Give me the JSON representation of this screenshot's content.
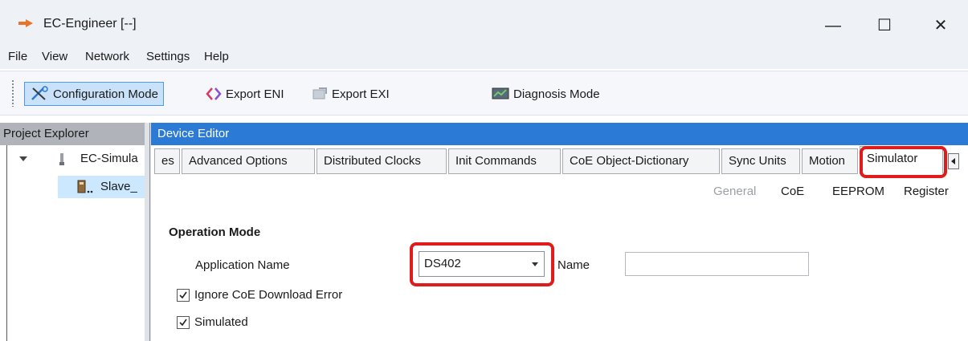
{
  "window": {
    "title": "EC-Engineer [--]",
    "controls": {
      "minimize": "—",
      "maximize": "☐",
      "close": "✕"
    }
  },
  "menu": {
    "items": [
      "File",
      "View",
      "Network",
      "Settings",
      "Help"
    ]
  },
  "toolbar": {
    "configuration_mode": "Configuration Mode",
    "export_eni": "Export ENI",
    "export_exi": "Export EXI",
    "diagnosis_mode": "Diagnosis Mode"
  },
  "project_explorer": {
    "title": "Project Explorer",
    "tree": [
      {
        "label": "EC-Simula",
        "icon": "network-node-icon",
        "expanded": true
      },
      {
        "label": "Slave_",
        "icon": "slave-device-icon",
        "selected": true
      }
    ]
  },
  "device_editor": {
    "title": "Device Editor",
    "tabs": [
      {
        "label": "es",
        "selected": false
      },
      {
        "label": "Advanced Options",
        "selected": false
      },
      {
        "label": "Distributed Clocks",
        "selected": false
      },
      {
        "label": "Init Commands",
        "selected": false
      },
      {
        "label": "CoE Object-Dictionary",
        "selected": false
      },
      {
        "label": "Sync Units",
        "selected": false
      },
      {
        "label": "Motion",
        "selected": false
      },
      {
        "label": "Simulator",
        "selected": true
      }
    ],
    "subnav": [
      {
        "label": "General",
        "active": true
      },
      {
        "label": "CoE",
        "active": false
      },
      {
        "label": "EEPROM",
        "active": false
      },
      {
        "label": "Register",
        "active": false
      }
    ],
    "operation_mode": {
      "title": "Operation Mode",
      "application_name_label": "Application Name",
      "application_name_value": "DS402",
      "name_label": "Name",
      "name_value": "",
      "ignore_coe_label": "Ignore CoE Download Error",
      "ignore_coe_checked": true,
      "simulated_label": "Simulated",
      "simulated_checked": true
    }
  },
  "colors": {
    "accent": "#2b7ad6",
    "highlight": "#e01b1b",
    "selection": "#cce8ff",
    "panel_header": "#b0b4ba"
  }
}
